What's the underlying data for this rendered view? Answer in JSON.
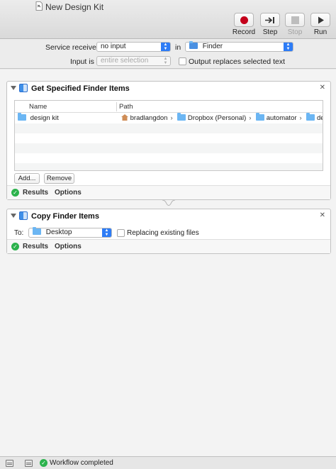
{
  "window": {
    "title": "New Design Kit"
  },
  "toolbar": {
    "record_label": "Record",
    "step_label": "Step",
    "stop_label": "Stop",
    "run_label": "Run",
    "accent": "#c4001b"
  },
  "service": {
    "receives_label": "Service receives",
    "receives_value": "no input",
    "in_label": "in",
    "app_value": "Finder",
    "input_is_label": "Input is",
    "input_is_value": "entire selection",
    "output_replaces_label": "Output replaces selected text"
  },
  "action1": {
    "title": "Get Specified Finder Items",
    "columns": [
      "Name",
      "Path"
    ],
    "rows": [
      {
        "name": "design kit",
        "path": [
          "bradlangdon",
          "Dropbox (Personal)",
          "automator",
          "design"
        ]
      }
    ],
    "add_label": "Add...",
    "remove_label": "Remove",
    "results_label": "Results",
    "options_label": "Options"
  },
  "action2": {
    "title": "Copy Finder Items",
    "to_label": "To:",
    "to_value": "Desktop",
    "replacing_label": "Replacing existing files",
    "results_label": "Results",
    "options_label": "Options"
  },
  "status": {
    "text": "Workflow completed"
  }
}
